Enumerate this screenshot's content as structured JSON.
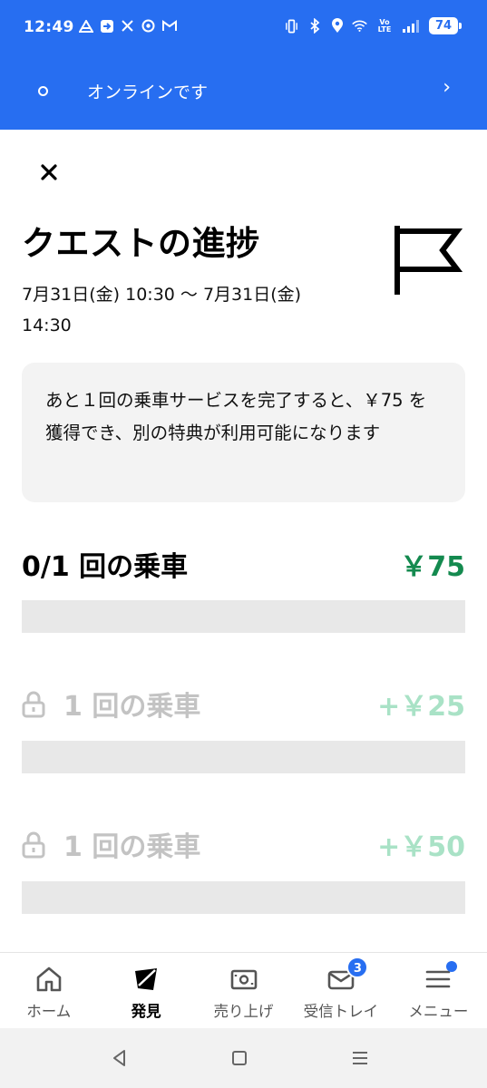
{
  "status_bar": {
    "time": "12:49",
    "left_icons": [
      "navigation-icon",
      "arrow-app-icon",
      "x-icon",
      "chrome-icon",
      "gmail-icon"
    ],
    "right_icons": [
      "vibrate-icon",
      "bluetooth-icon",
      "location-icon",
      "wifi-icon",
      "volte-icon",
      "signal-icon"
    ],
    "volte": "Vo\nLTE",
    "battery": "74"
  },
  "online_bar": {
    "status_text": "オンラインです",
    "chevron": "›"
  },
  "quest": {
    "close_symbol": "×",
    "title": "クエストの進捗",
    "period_line1": "7月31日(金) 10:30 〜 7月31日(金)",
    "period_line2": "14:30",
    "message": "あと１回の乗車サービスを完了すると、￥75 を獲得でき、別の特典が利用可能になります",
    "tiers": [
      {
        "label": "0/1 回の乗車",
        "amount": "￥75",
        "progress": 0,
        "locked": false
      },
      {
        "label": "1 回の乗車",
        "amount": "+￥25",
        "progress": 0,
        "locked": true
      },
      {
        "label": "1 回の乗車",
        "amount": "+￥50",
        "progress": 0,
        "locked": true
      }
    ]
  },
  "bottom_nav": {
    "items": [
      {
        "label": "ホーム",
        "icon": "home-icon"
      },
      {
        "label": "発見",
        "icon": "discover-icon",
        "selected": true
      },
      {
        "label": "売り上げ",
        "icon": "earnings-icon"
      },
      {
        "label": "受信トレイ",
        "icon": "inbox-icon",
        "badge": "3"
      },
      {
        "label": "メニュー",
        "icon": "menu-icon",
        "dot": true
      }
    ]
  },
  "colors": {
    "brand_blue": "#276ef1",
    "money_green": "#148a4f",
    "locked_green": "#a9e2c6",
    "progress_track": "#e8e8e8"
  }
}
